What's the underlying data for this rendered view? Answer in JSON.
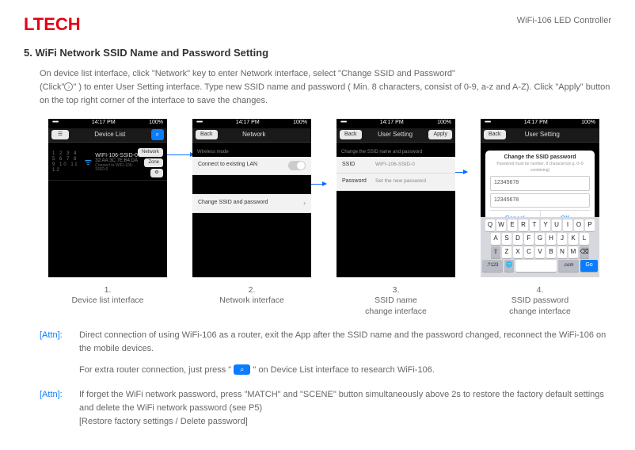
{
  "header": {
    "logo": "LTECH",
    "product": "WiFi-106 LED Controller"
  },
  "section": {
    "title": "5. WiFi Network SSID Name and Password Setting",
    "intro_a": "On device list interface, click \"Network\" key to enter Network interface, select \"Change SSID and Password\"",
    "intro_b": "(Click\"",
    "intro_c": "\" ) to enter User Setting interface. Type new SSID name and password ( Min. 8 characters, consist of 0-9, a-z and A-Z). Click \"Apply\" button on the top right corner of the interface to save the changes."
  },
  "common": {
    "time": "14:17 PM",
    "battery": "100%",
    "signal": "•••••",
    "wifi_glyph": "ᯤ",
    "back": "Back",
    "chevron": "›"
  },
  "screen1": {
    "title": "Device List",
    "search_glyph": "⌕",
    "nums1": "1 2 3 4",
    "nums2": "5 6 7 8",
    "nums3": "9 10 11 12",
    "dev_name": "WIFI-106-SSID-0",
    "dev_mac": "32:AA:3C:7E:B4:DA",
    "dev_sub": "Connect to WIFI-106-SSID-0",
    "pill1": "Network",
    "pill2": "Zone",
    "gear": "⚙",
    "caption_num": "1.",
    "caption": "Device list interface"
  },
  "screen2": {
    "title": "Network",
    "section_lbl": "Wireless mode",
    "row1": "Connect to existing LAN",
    "row2": "Change SSID and password",
    "caption_num": "2.",
    "caption": "Network interface"
  },
  "screen3": {
    "title": "User Setting",
    "apply": "Apply",
    "section_lbl": "Change the SSID name and password",
    "ssid_lbl": "SSID",
    "ssid_val": "WIFI-106-SSID-0",
    "pwd_lbl": "Password",
    "pwd_val": "Set the new password",
    "caption_num": "3.",
    "caption_a": "SSID name",
    "caption_b": "change  interface"
  },
  "screen4": {
    "title": "User Setting",
    "dlg_title": "Change the SSID password",
    "dlg_sub": "Password must be number, 8 characters(e.g. 0–9 combining)",
    "pwd1": "12345678",
    "pwd2": "12345678",
    "cancel": "Cancel",
    "ok": "OK",
    "caption_num": "4.",
    "caption_a": "SSID password",
    "caption_b": "change  interface",
    "k_del": "⌫",
    "k_shift": "⇧",
    "k_num": ".?123",
    "k_globe": "🌐",
    "k_com": ".com",
    "k_go": "Go"
  },
  "attn1": {
    "label": "[Attn]:",
    "p1": "Direct connection of using WiFi-106 as a router, exit the App after the SSID name and the password changed, reconnect the WiFi-106 on the mobile devices.",
    "p2a": "For extra router connection, just press  \" ",
    "p2_glyph": "⌕",
    "p2b": " \" on Device List interface to research WiFi-106."
  },
  "attn2": {
    "label": "[Attn]:",
    "p1": "If forget the WiFi network password, press \"MATCH\" and \"SCENE\" button simultaneously above 2s to restore the factory default settings and delete the WiFi network password (see P5)",
    "p2": "[Restore factory settings / Delete password]"
  },
  "keys": {
    "r1": [
      "Q",
      "W",
      "E",
      "R",
      "T",
      "Y",
      "U",
      "I",
      "O",
      "P"
    ],
    "r2": [
      "A",
      "S",
      "D",
      "F",
      "G",
      "H",
      "J",
      "K",
      "L"
    ],
    "r3": [
      "Z",
      "X",
      "C",
      "V",
      "B",
      "N",
      "M"
    ]
  }
}
